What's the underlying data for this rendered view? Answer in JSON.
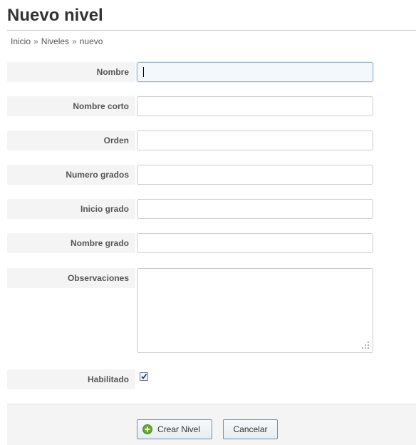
{
  "page": {
    "title": "Nuevo nivel"
  },
  "breadcrumb": [
    {
      "label": "Inicio"
    },
    {
      "label": "Niveles"
    },
    {
      "label": "nuevo"
    }
  ],
  "breadcrumb_separator": "»",
  "form": {
    "nombre": {
      "label": "Nombre",
      "value": ""
    },
    "nombre_corto": {
      "label": "Nombre corto",
      "value": ""
    },
    "orden": {
      "label": "Orden",
      "value": ""
    },
    "numero_grados": {
      "label": "Numero grados",
      "value": ""
    },
    "inicio_grado": {
      "label": "Inicio grado",
      "value": ""
    },
    "nombre_grado": {
      "label": "Nombre grado",
      "value": ""
    },
    "observaciones": {
      "label": "Observaciones",
      "value": ""
    },
    "habilitado": {
      "label": "Habilitado",
      "checked": true
    }
  },
  "actions": {
    "create_label": "Crear Nivel",
    "cancel_label": "Cancelar",
    "create_icon": "plus-circle-icon"
  },
  "colors": {
    "focus_border": "#8fb1cf",
    "create_icon": "#6aa632"
  }
}
